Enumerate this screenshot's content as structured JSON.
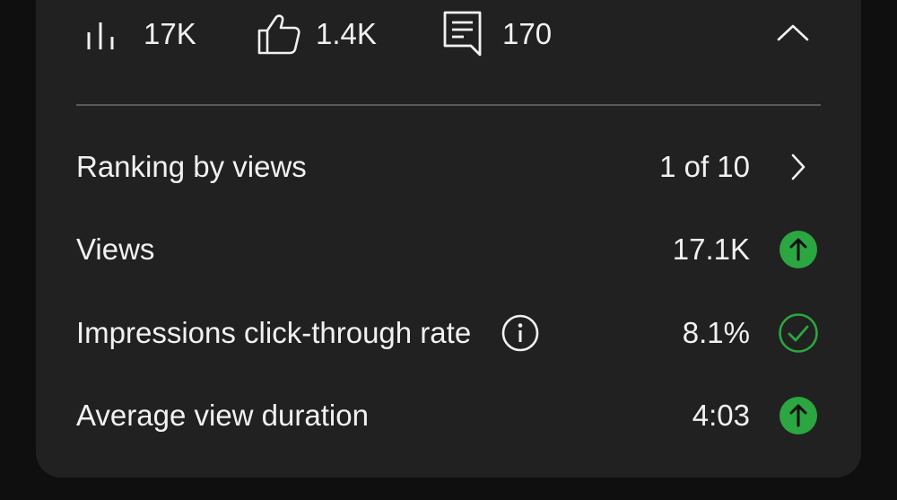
{
  "stats": {
    "views": {
      "icon": "bar-chart-icon",
      "value": "17K"
    },
    "likes": {
      "icon": "thumbs-up-icon",
      "value": "1.4K"
    },
    "comments": {
      "icon": "comment-icon",
      "value": "170"
    },
    "collapse_icon": "chevron-up-icon"
  },
  "metrics": [
    {
      "label": "Ranking by views",
      "value": "1 of 10",
      "status_icon": "chevron-right-icon"
    },
    {
      "label": "Views",
      "value": "17.1K",
      "status_icon": "arrow-up-circle-icon"
    },
    {
      "label": "Impressions click-through rate",
      "value": "8.1%",
      "info_icon": "info-icon",
      "status_icon": "check-circle-icon"
    },
    {
      "label": "Average view duration",
      "value": "4:03",
      "status_icon": "arrow-up-circle-icon"
    }
  ],
  "colors": {
    "card_background": "#212121",
    "page_background": "#0f0f0f",
    "text": "#f1f1f1",
    "positive_green": "#2ba640",
    "divider": "#5a5a5a"
  }
}
